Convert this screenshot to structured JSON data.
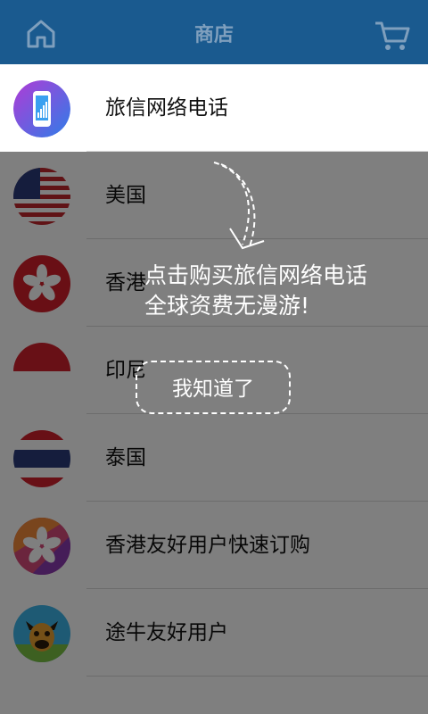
{
  "header": {
    "title": "商店",
    "background": "#1a5a8f"
  },
  "list": {
    "items": [
      {
        "label": "旅信网络电话",
        "icon": "phone-app-icon"
      },
      {
        "label": "美国",
        "icon": "usa-flag-icon"
      },
      {
        "label": "香港",
        "icon": "hongkong-flag-icon"
      },
      {
        "label": "印尼",
        "icon": "indonesia-flag-icon"
      },
      {
        "label": "泰国",
        "icon": "thailand-flag-icon"
      },
      {
        "label": "香港友好用户快速订购",
        "icon": "hongkong-friendly-icon"
      },
      {
        "label": "途牛友好用户",
        "icon": "tuniu-cow-icon"
      }
    ]
  },
  "guide": {
    "line1": "点击购买旅信网络电话",
    "line2": "全球资费无漫游!",
    "button_label": "我知道了"
  }
}
